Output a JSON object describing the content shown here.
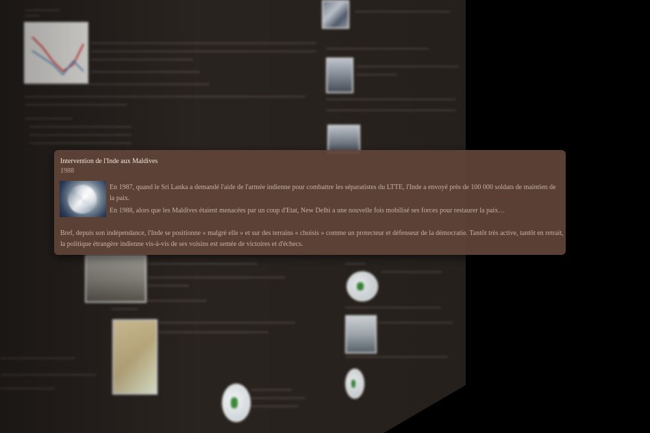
{
  "popup": {
    "title": "Intervention de l'Inde aux Maldives",
    "year": "1988",
    "image_icon": "cyclone-satellite-image",
    "paragraph_1": "En 1987, quand le Sri Lanka a demandé l'aide de l'armée indienne pour combattre les séparatistes du LTTE, l'Inde a envoyé près de 100 000 soldats de maintien de la paix.",
    "paragraph_2": "En 1988, alors que les Maldives étaient menacées par un coup d'Etat, New Delhi a une nouvelle fois mobilisé ses forces pour restaurer la paix…",
    "paragraph_3": "Bref, depuis son indépendance, l'Inde se positionne « malgré elle » et sur des terrains « choisis » comme un protecteur et défenseur de la démocratie. Tantôt très active, tantôt en retrait, la politique étrangère indienne vis-à-vis de ses voisins est semée de victoires et d'échecs."
  },
  "background_wall": {
    "icons": [
      "line-chart-thumbnail",
      "crowd-photo-thumbnail",
      "city-photo-thumbnail",
      "tank-photo-thumbnail",
      "map-thumbnail",
      "globe-icon",
      "sea-photo-thumbnail"
    ]
  }
}
